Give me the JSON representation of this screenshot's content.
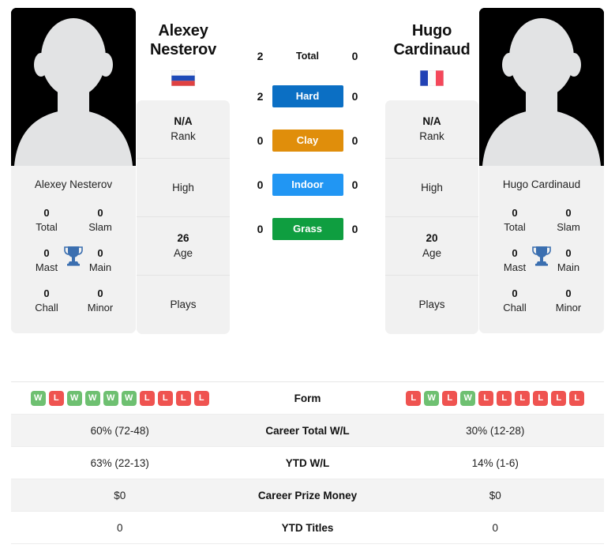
{
  "colors": {
    "win": "#6ec071",
    "loss": "#ef5350",
    "trophy": "#3b6fb0",
    "row_shaded": "#f3f3f3",
    "card_bg": "#f1f1f1"
  },
  "left_player": {
    "name_line1": "Alexey",
    "name_line2": "Nesterov",
    "full_name": "Alexey Nesterov",
    "flag": "russia-flag",
    "titles": [
      {
        "value": "0",
        "label": "Total"
      },
      {
        "value": "0",
        "label": "Slam"
      },
      {
        "value": "0",
        "label": "Mast"
      },
      {
        "value": "0",
        "label": "Main"
      },
      {
        "value": "0",
        "label": "Chall"
      },
      {
        "value": "0",
        "label": "Minor"
      }
    ],
    "info": [
      {
        "value": "N/A",
        "label": "Rank"
      },
      {
        "value": "",
        "label": "High"
      },
      {
        "value": "26",
        "label": "Age"
      },
      {
        "value": "",
        "label": "Plays"
      }
    ]
  },
  "right_player": {
    "name_line1": "Hugo",
    "name_line2": "Cardinaud",
    "full_name": "Hugo Cardinaud",
    "flag": "france-flag",
    "titles": [
      {
        "value": "0",
        "label": "Total"
      },
      {
        "value": "0",
        "label": "Slam"
      },
      {
        "value": "0",
        "label": "Mast"
      },
      {
        "value": "0",
        "label": "Main"
      },
      {
        "value": "0",
        "label": "Chall"
      },
      {
        "value": "0",
        "label": "Minor"
      }
    ],
    "info": [
      {
        "value": "N/A",
        "label": "Rank"
      },
      {
        "value": "",
        "label": "High"
      },
      {
        "value": "20",
        "label": "Age"
      },
      {
        "value": "",
        "label": "Plays"
      }
    ]
  },
  "head_to_head": {
    "total": {
      "label": "Total",
      "left": "2",
      "right": "0"
    },
    "surfaces": [
      {
        "label": "Hard",
        "left": "2",
        "right": "0",
        "color": "#0b6fc4"
      },
      {
        "label": "Clay",
        "left": "0",
        "right": "0",
        "color": "#e08e0b"
      },
      {
        "label": "Indoor",
        "left": "0",
        "right": "0",
        "color": "#2196f3"
      },
      {
        "label": "Grass",
        "left": "0",
        "right": "0",
        "color": "#0f9e40"
      }
    ]
  },
  "stats": {
    "form": {
      "label": "Form",
      "left": [
        "W",
        "L",
        "W",
        "W",
        "W",
        "W",
        "L",
        "L",
        "L",
        "L"
      ],
      "right": [
        "L",
        "W",
        "L",
        "W",
        "L",
        "L",
        "L",
        "L",
        "L",
        "L"
      ]
    },
    "rows": [
      {
        "label": "Career Total W/L",
        "left": "60% (72-48)",
        "right": "30% (12-28)"
      },
      {
        "label": "YTD W/L",
        "left": "63% (22-13)",
        "right": "14% (1-6)"
      },
      {
        "label": "Career Prize Money",
        "left": "$0",
        "right": "$0"
      },
      {
        "label": "YTD Titles",
        "left": "0",
        "right": "0"
      }
    ]
  }
}
